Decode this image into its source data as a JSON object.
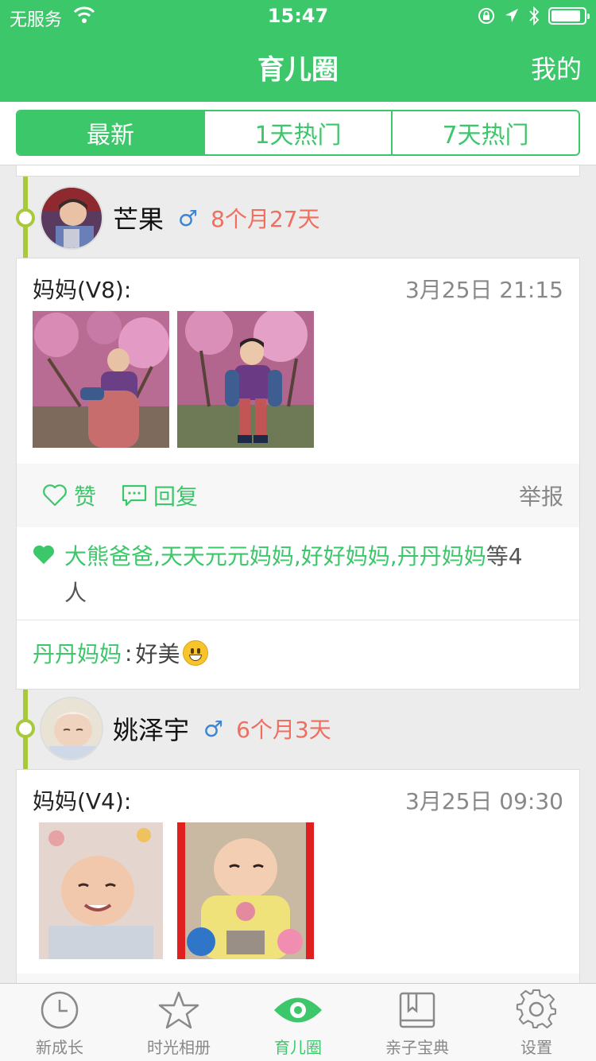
{
  "status_bar": {
    "carrier": "无服务",
    "time": "15:47",
    "battery_level": 0.9
  },
  "nav": {
    "title": "育儿圈",
    "right_label": "我的"
  },
  "segments": [
    {
      "label": "最新",
      "active": true
    },
    {
      "label": "1天热门",
      "active": false
    },
    {
      "label": "7天热门",
      "active": false
    }
  ],
  "posts": [
    {
      "baby_name": "芒果",
      "gender_symbol": "♂",
      "age": "8个月27天",
      "author": "妈妈(V8):",
      "time": "3月25日 21:15",
      "like_label": "赞",
      "reply_label": "回复",
      "report_label": "举报",
      "likers": "大熊爸爸,天天元元妈妈,好好妈妈,丹丹妈妈",
      "likers_suffix": "等4人",
      "comment_name": "丹丹妈妈",
      "comment_sep": ":",
      "comment_text": "好美"
    },
    {
      "baby_name": "姚泽宇",
      "gender_symbol": "♂",
      "age": "6个月3天",
      "author": "妈妈(V4):",
      "time": "3月25日 09:30"
    }
  ],
  "tabbar": [
    {
      "label": "新成长",
      "icon": "clock-icon",
      "active": false
    },
    {
      "label": "时光相册",
      "icon": "star-icon",
      "active": false
    },
    {
      "label": "育儿圈",
      "icon": "eye-icon",
      "active": true
    },
    {
      "label": "亲子宝典",
      "icon": "book-icon",
      "active": false
    },
    {
      "label": "设置",
      "icon": "gear-icon",
      "active": false
    }
  ],
  "colors": {
    "accent": "#3dc76b",
    "age": "#f06e5e",
    "gender": "#3a86d6",
    "timeline": "#a8c93a"
  }
}
